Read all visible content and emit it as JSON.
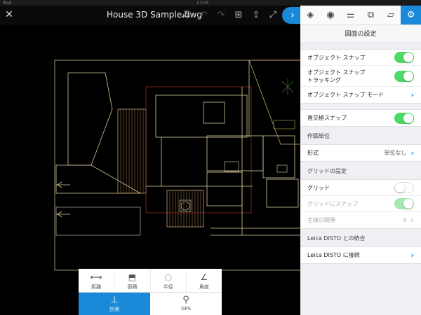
{
  "statusbar": {
    "carrier": "iPad",
    "time": "17:05",
    "battery": ""
  },
  "toolbar": {
    "close_icon": "close-icon",
    "title": "House 3D Sample.dwg",
    "icons": [
      "snap-icon",
      "undo-icon",
      "redo-icon",
      "layout-icon",
      "share-icon",
      "fullscreen-icon",
      "next-icon"
    ]
  },
  "measure": {
    "tools": [
      {
        "label": "距離",
        "icon": "distance-icon"
      },
      {
        "label": "面積",
        "icon": "area-icon"
      },
      {
        "label": "半径",
        "icon": "radius-icon"
      },
      {
        "label": "角度",
        "icon": "angle-icon"
      }
    ],
    "tabs": [
      {
        "label": "計測",
        "icon": "measure-icon",
        "active": true
      },
      {
        "label": "GPS",
        "icon": "location-pin-icon",
        "active": false
      }
    ]
  },
  "panel": {
    "tabs": [
      "layers-icon",
      "eye-icon",
      "sliders-icon",
      "shapes-icon",
      "comment-icon",
      "gear-icon"
    ],
    "title": "図面の設定",
    "snap_group": [
      {
        "label": "オブジェクト スナップ",
        "control": "toggle",
        "on": true
      },
      {
        "label": "オブジェクト スナップ\nトラッキング",
        "control": "toggle",
        "on": true
      },
      {
        "label": "オブジェクト スナップ モード",
        "control": "chevron"
      }
    ],
    "ortho": {
      "label": "直交極スナップ",
      "on": true
    },
    "units_section": "作図単位",
    "units_row": {
      "label": "形式",
      "value": "単位なし"
    },
    "grid_section": "グリッドの設定",
    "grid_rows": [
      {
        "label": "グリッド",
        "control": "toggle",
        "on": false,
        "disabled": false
      },
      {
        "label": "グリッドにスナップ",
        "control": "toggle",
        "on": true,
        "disabled": true
      },
      {
        "label": "主線の間隔",
        "control": "chevron",
        "value": "5",
        "disabled": true
      }
    ],
    "disto_section": "Leica DISTO との統合",
    "disto_row": {
      "label": "Leica DISTO に接続"
    }
  },
  "colors": {
    "accent": "#1a8ad8",
    "toggle_on": "#4cd964",
    "cad_line": "#d8c89a",
    "cad_red": "#c0392b"
  }
}
